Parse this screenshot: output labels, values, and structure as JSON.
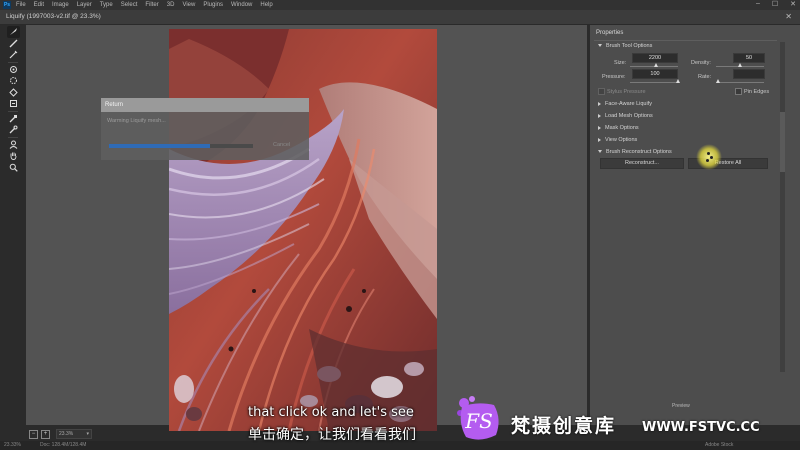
{
  "menubar": {
    "logo": "Ps",
    "items": [
      "File",
      "Edit",
      "Image",
      "Layer",
      "Type",
      "Select",
      "Filter",
      "3D",
      "View",
      "Plugins",
      "Window",
      "Help"
    ]
  },
  "window": {
    "title": "Liquify (1997003-v2.tif @ 23.3%)"
  },
  "tools": [
    "forward-warp-tool-icon",
    "reconstruct-tool-icon",
    "smooth-tool-icon",
    "twirl-tool-icon",
    "pucker-tool-icon",
    "bloat-tool-icon",
    "push-left-tool-icon",
    "freeze-mask-tool-icon",
    "thaw-mask-tool-icon",
    "face-tool-icon",
    "hand-tool-icon",
    "zoom-tool-icon"
  ],
  "dialog": {
    "title": "Return",
    "message": "Warming Liquify mesh...",
    "progress": 0.7,
    "cancel_label": "Cancel"
  },
  "panel": {
    "title": "Properties",
    "brush_tool_options": {
      "label": "Brush Tool Options",
      "size_label": "Size:",
      "size_value": "2200",
      "density_label": "Density:",
      "density_value": "50",
      "pressure_label": "Pressure:",
      "pressure_value": "100",
      "rate_label": "Rate:",
      "rate_value": "",
      "stylus_label": "Stylus Pressure",
      "pin_edges_label": "Pin Edges"
    },
    "sections": {
      "face_aware": "Face-Aware Liquify",
      "load_mesh": "Load Mesh Options",
      "mask": "Mask Options",
      "view": "View Options"
    },
    "reconstruct": {
      "label": "Brush Reconstruct Options",
      "reconstruct_button": "Reconstruct...",
      "restore_all_button": "Restore All"
    },
    "footer": "Preview"
  },
  "bottom": {
    "zoom_value": "23.3%"
  },
  "status": {
    "left": "23.33%",
    "doc": "Doc: 128.4M/128.4M",
    "right": "Adobe Stock"
  },
  "subtitles": {
    "english": "that click ok and let's see",
    "chinese": "单击确定，让我们看看我们"
  },
  "watermark": {
    "logo": "FS",
    "brand": "梵摄创意库",
    "url": "WWW.FSTVC.CC"
  },
  "colors": {
    "progress": "#2f6bb6",
    "cursor_highlight": "#f0e650",
    "watermark_purple": "#b45cf0"
  }
}
